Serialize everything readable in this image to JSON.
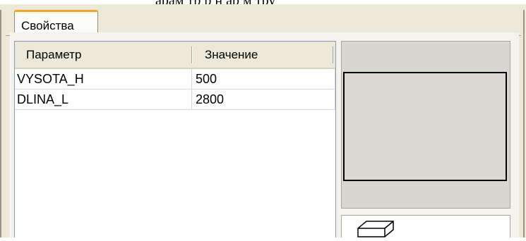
{
  "title_fragment": "арам  тр     р  н  ар м тру",
  "tabs": [
    {
      "label": "Свойства",
      "active": true
    }
  ],
  "table": {
    "columns": [
      "Параметр",
      "Значение"
    ],
    "rows": [
      {
        "name": "VYSOTA_H",
        "value": "500"
      },
      {
        "name": "DLINA_L",
        "value": "2800"
      }
    ]
  },
  "icons": {
    "preview_tool": "3d-box-icon"
  },
  "colors": {
    "tab_accent": "#f7a31f",
    "panel_bg": "#ece9d8",
    "grid_border": "#7f9db9"
  }
}
